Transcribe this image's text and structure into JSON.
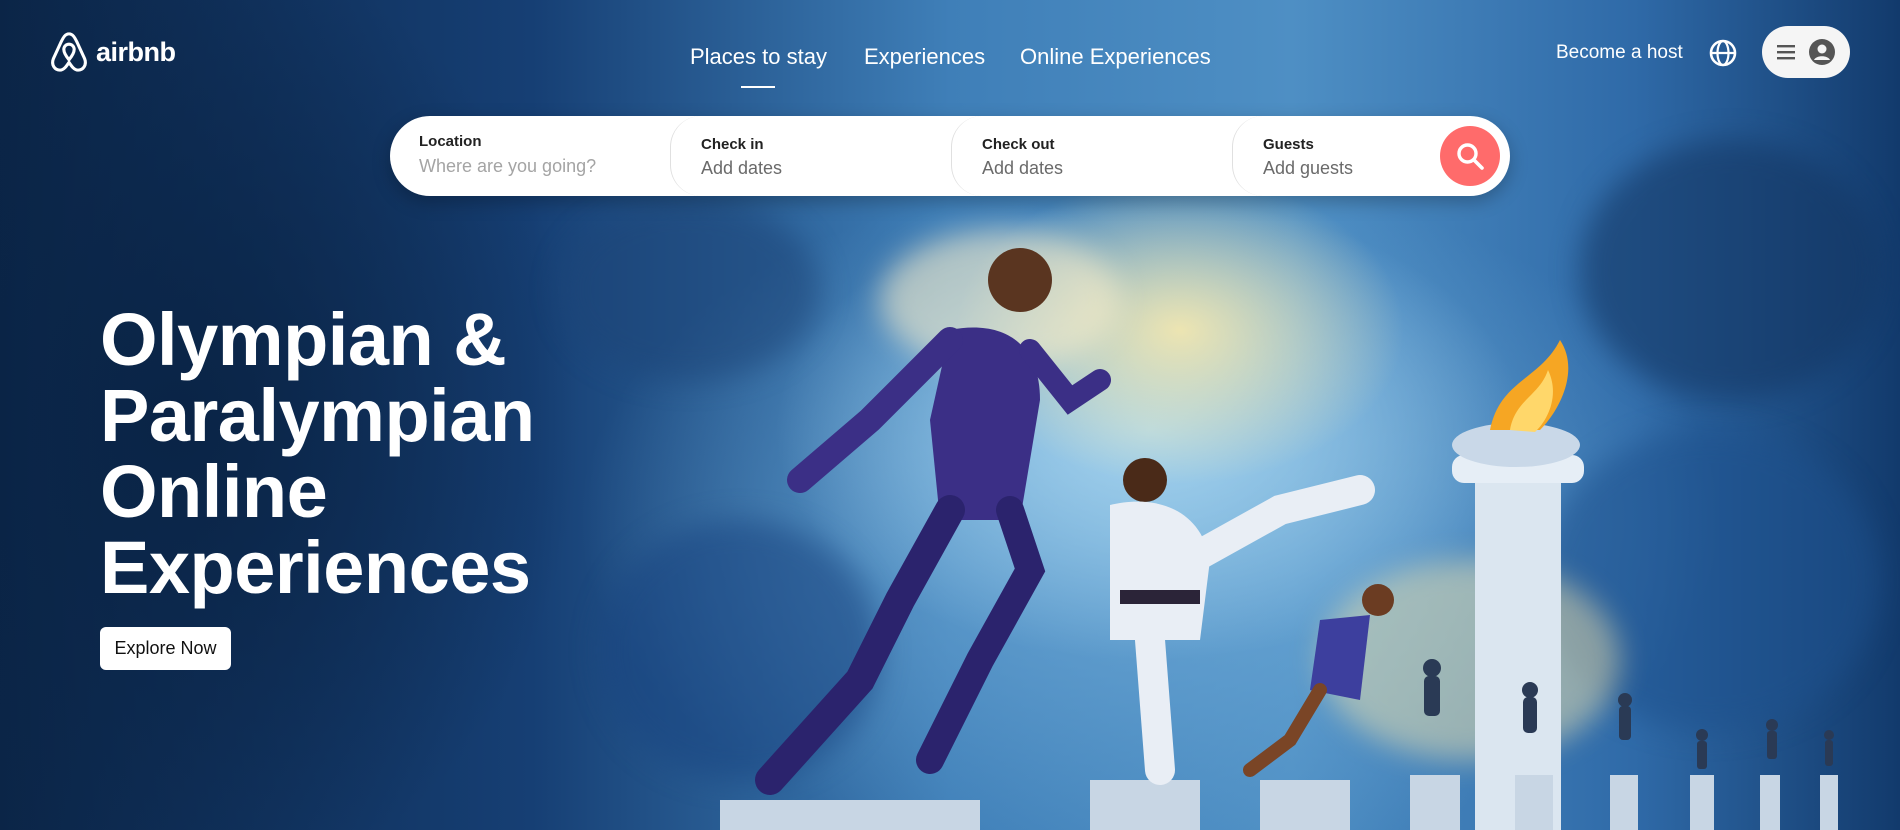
{
  "brand": {
    "name": "airbnb",
    "accent": "#FF6B6B"
  },
  "nav": {
    "items": [
      {
        "label": "Places to stay",
        "active": true
      },
      {
        "label": "Experiences",
        "active": false
      },
      {
        "label": "Online Experiences",
        "active": false
      }
    ]
  },
  "header_right": {
    "host_label": "Become a host",
    "globe_icon": "globe-icon",
    "menu_icon": "hamburger-icon",
    "avatar_icon": "user-circle-icon"
  },
  "search": {
    "location": {
      "label": "Location",
      "placeholder": "Where are you going?"
    },
    "check_in": {
      "label": "Check in",
      "value": "Add dates"
    },
    "check_out": {
      "label": "Check out",
      "value": "Add dates"
    },
    "guests": {
      "label": "Guests",
      "value": "Add guests"
    },
    "button_icon": "search-icon"
  },
  "hero": {
    "headline_lines": [
      "Olympian &",
      "Paralympian",
      "Online",
      "Experiences"
    ],
    "cta_label": "Explore Now"
  }
}
